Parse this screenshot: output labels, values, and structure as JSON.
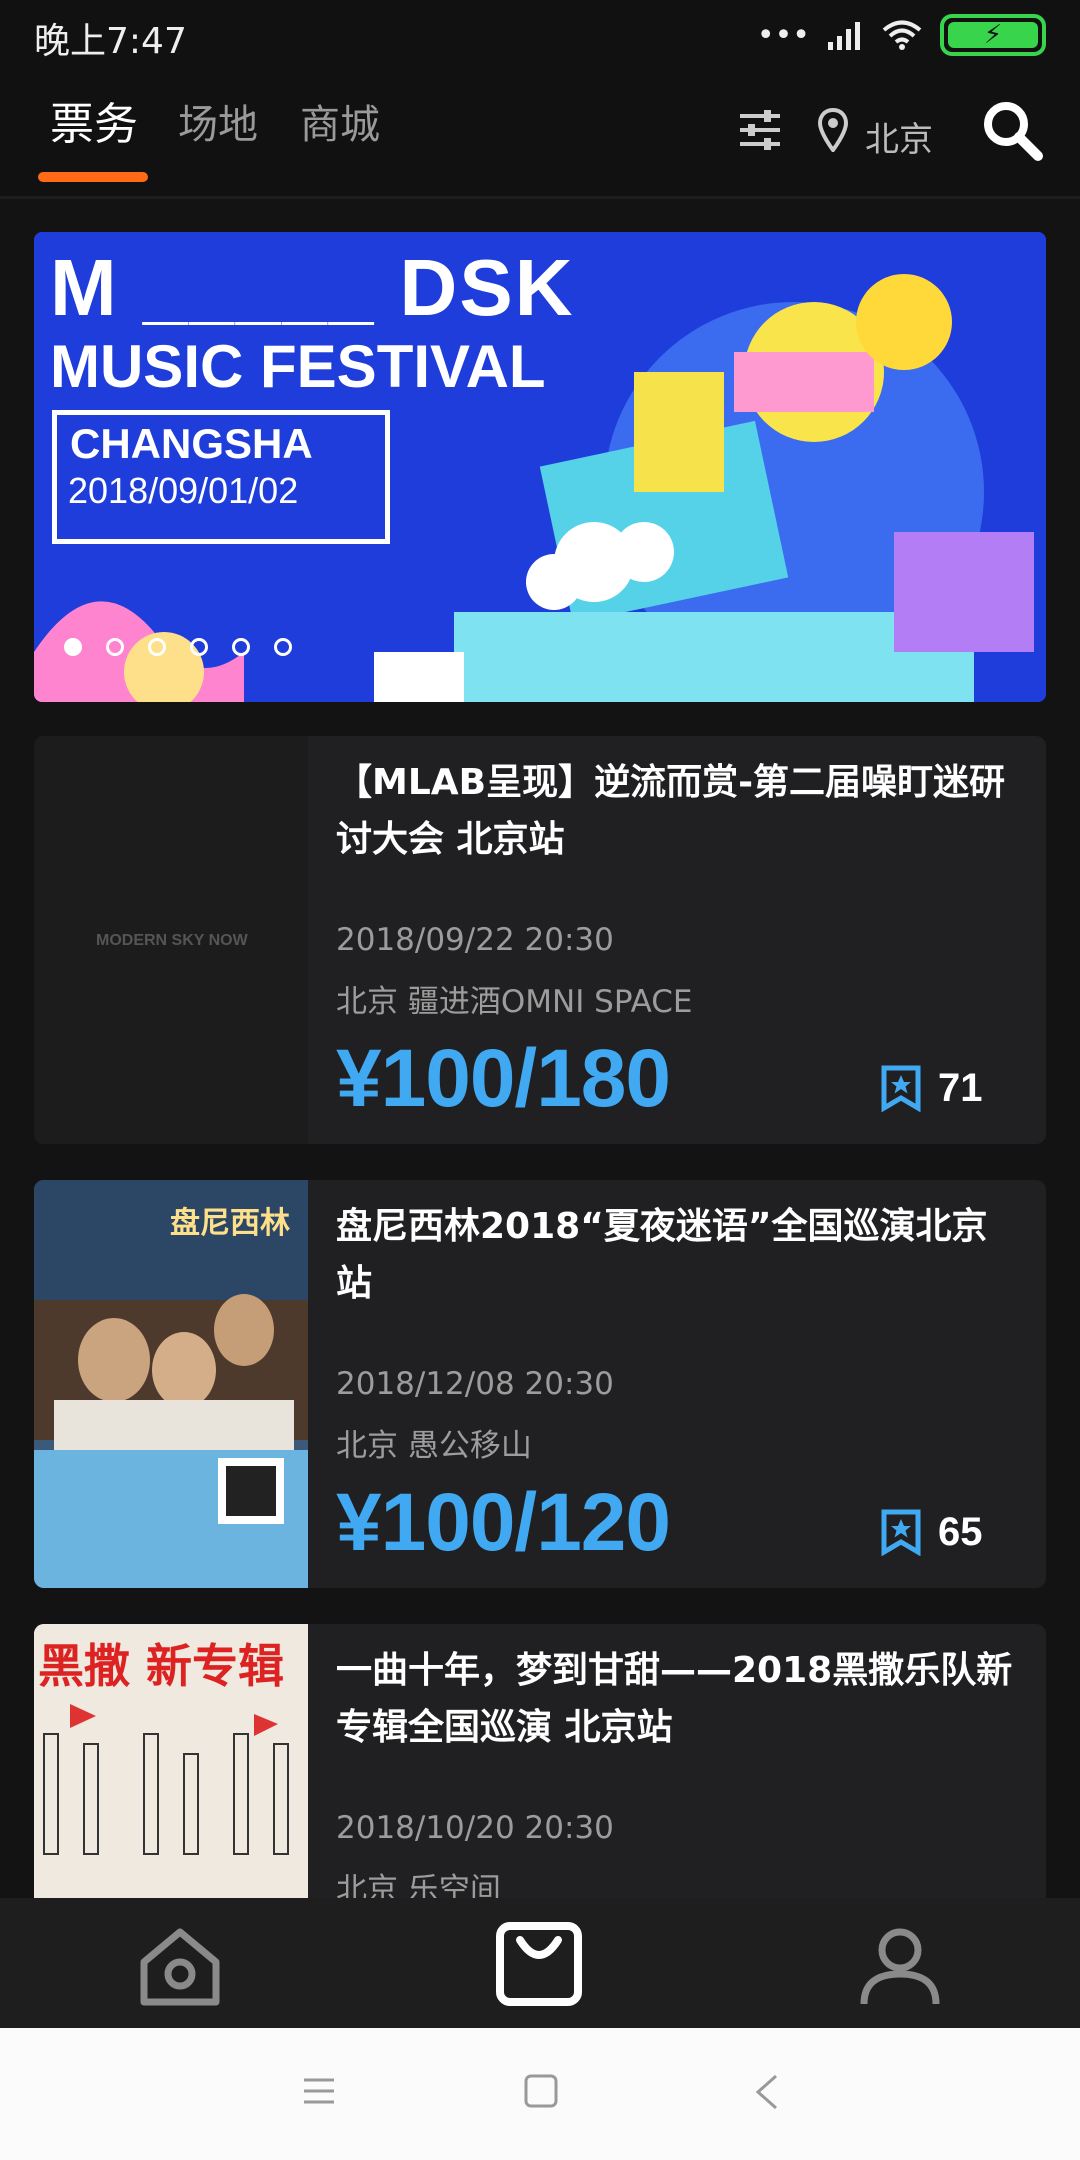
{
  "status_bar": {
    "time": "晚上7:47",
    "signal": "•••"
  },
  "header": {
    "tabs": [
      {
        "label": "票务",
        "active": true
      },
      {
        "label": "场地",
        "active": false
      },
      {
        "label": "商城",
        "active": false
      }
    ],
    "city": "北京",
    "accent": "#ff6a16"
  },
  "banner": {
    "line1": "M _____ DSK",
    "line2": "MUSIC FESTIVAL",
    "line3": "CHANGSHA",
    "line4": "2018/09/01/02",
    "slides": 6,
    "active_slide": 1
  },
  "events": [
    {
      "title": "【MLAB呈现】逆流而赏-第二届噪盯迷研讨大会 北京站",
      "date": "2018/09/22 20:30",
      "venue": "北京 疆进酒OMNI SPACE",
      "price": "¥100/180",
      "favorites": "71",
      "poster_text": "MODERN SKY NOW"
    },
    {
      "title": "盘尼西林2018“夏夜迷语”全国巡演北京站",
      "date": "2018/12/08 20:30",
      "venue": "北京 愚公移山",
      "price": "¥100/120",
      "favorites": "65",
      "poster_text": "盘尼西林"
    },
    {
      "title": "一曲十年，梦到甘甜——2018黑撒乐队新专辑全国巡演 北京站",
      "date": "2018/10/20 20:30",
      "venue": "北京 乐空间",
      "poster_text": "黑撒 新专辑"
    }
  ],
  "colors": {
    "price": "#41a9f1",
    "background": "#131314",
    "card": "#202022"
  }
}
